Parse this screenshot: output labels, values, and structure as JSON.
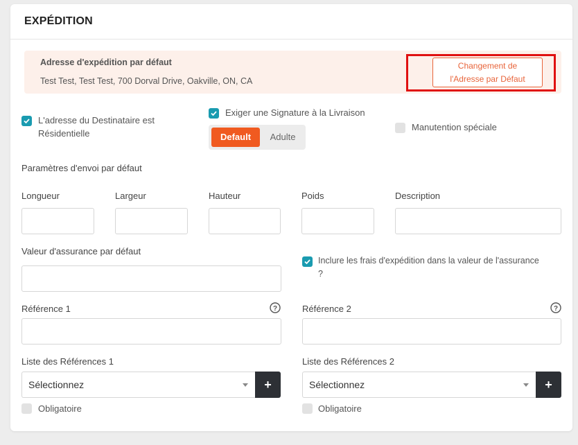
{
  "section": {
    "title": "EXPÉDITION"
  },
  "default_address": {
    "title": "Adresse d'expédition par défaut",
    "text": "Test Test, Test Test, 700 Dorval Drive, Oakville, ON, CA",
    "change_button_line1": "Changement de",
    "change_button_line2": "l'Adresse par Défaut"
  },
  "options": {
    "residential": {
      "label_line1": "L'adresse du Destinataire est",
      "label_line2": "Résidentielle",
      "checked": true
    },
    "signature": {
      "label": "Exiger une Signature à la Livraison",
      "checked": true
    },
    "signature_type": {
      "options": [
        "Default",
        "Adulte"
      ],
      "selected": "Default"
    },
    "special_handling": {
      "label": "Manutention spéciale",
      "checked": false
    }
  },
  "default_params": {
    "heading": "Paramètres d'envoi par défaut",
    "length_label": "Longueur",
    "width_label": "Largeur",
    "height_label": "Hauteur",
    "weight_label": "Poids",
    "description_label": "Description",
    "length_value": "",
    "width_value": "",
    "height_value": "",
    "weight_value": "",
    "description_value": ""
  },
  "insurance": {
    "label": "Valeur d'assurance par défaut",
    "value": "",
    "include_fees_line1": "Inclure les frais d'expédition dans la valeur de l'assurance",
    "include_fees_line2": "?",
    "include_fees_checked": true
  },
  "references": {
    "ref1_label": "Référence 1",
    "ref2_label": "Référence 2",
    "ref1_value": "",
    "ref2_value": "",
    "list1_label": "Liste des Références 1",
    "list2_label": "Liste des Références 2",
    "list1_selected": "Sélectionnez",
    "list2_selected": "Sélectionnez",
    "required_label_1": "Obligatoire",
    "required_label_2": "Obligatoire",
    "required_1_checked": false,
    "required_2_checked": false
  },
  "colors": {
    "accent": "#f05a20",
    "checkbox": "#1a9bb0",
    "highlight": "#e01010",
    "address_bg": "#fdf0ea",
    "plus_button": "#2d3035"
  }
}
